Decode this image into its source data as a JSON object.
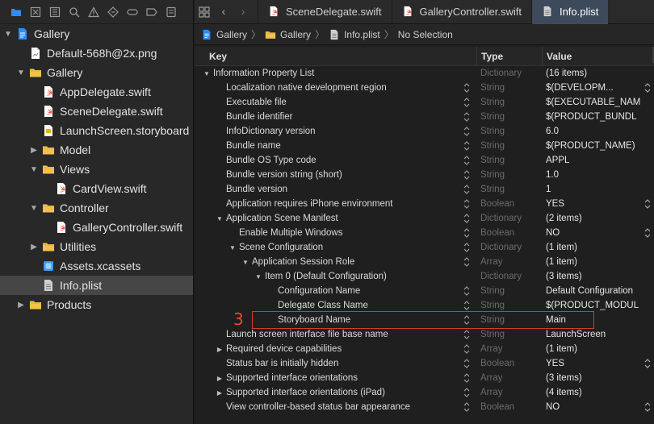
{
  "navigator": {
    "toolbar_icons": [
      "folder-icon",
      "x-square-icon",
      "hierarchy-icon",
      "search-icon",
      "warning-icon",
      "test-icon",
      "debug-icon",
      "breakpoint-icon",
      "report-icon"
    ],
    "tree": [
      {
        "label": "Gallery",
        "level": 0,
        "expanded": true,
        "kind": "project"
      },
      {
        "label": "Default-568h@2x.png",
        "level": 1,
        "kind": "file"
      },
      {
        "label": "Gallery",
        "level": 1,
        "expanded": true,
        "kind": "folder"
      },
      {
        "label": "AppDelegate.swift",
        "level": 2,
        "kind": "swift"
      },
      {
        "label": "SceneDelegate.swift",
        "level": 2,
        "kind": "swift"
      },
      {
        "label": "LaunchScreen.storyboard",
        "level": 2,
        "kind": "storyboard"
      },
      {
        "label": "Model",
        "level": 2,
        "expanded": false,
        "kind": "folder"
      },
      {
        "label": "Views",
        "level": 2,
        "expanded": true,
        "kind": "folder"
      },
      {
        "label": "CardView.swift",
        "level": 3,
        "kind": "swift"
      },
      {
        "label": "Controller",
        "level": 2,
        "expanded": true,
        "kind": "folder"
      },
      {
        "label": "GalleryController.swift",
        "level": 3,
        "kind": "swift"
      },
      {
        "label": "Utilities",
        "level": 2,
        "expanded": false,
        "kind": "folder"
      },
      {
        "label": "Assets.xcassets",
        "level": 2,
        "kind": "assets"
      },
      {
        "label": "Info.plist",
        "level": 2,
        "kind": "plist",
        "selected": true
      },
      {
        "label": "Products",
        "level": 1,
        "expanded": false,
        "kind": "folder"
      }
    ]
  },
  "tabs": [
    {
      "label": "SceneDelegate.swift",
      "active": false,
      "kind": "swift"
    },
    {
      "label": "GalleryController.swift",
      "active": false,
      "kind": "swift"
    },
    {
      "label": "Info.plist",
      "active": true,
      "kind": "plist"
    }
  ],
  "jumpbar": {
    "items": [
      {
        "label": "Gallery",
        "kind": "project"
      },
      {
        "label": "Gallery",
        "kind": "folder"
      },
      {
        "label": "Info.plist",
        "kind": "plist"
      },
      {
        "label": "No Selection",
        "kind": "none"
      }
    ]
  },
  "plist": {
    "headers": {
      "key": "Key",
      "type": "Type",
      "value": "Value"
    },
    "rows": [
      {
        "key": "Information Property List",
        "type": "Dictionary",
        "value": "(16 items)",
        "indent": 0,
        "disclosure": "open",
        "stepper": false,
        "popup": false
      },
      {
        "key": "Localization native development region",
        "type": "String",
        "value": "$(DEVELOPM...",
        "indent": 1,
        "disclosure": "none",
        "stepper": true,
        "popup": true
      },
      {
        "key": "Executable file",
        "type": "String",
        "value": "$(EXECUTABLE_NAM",
        "indent": 1,
        "disclosure": "none",
        "stepper": true,
        "popup": false
      },
      {
        "key": "Bundle identifier",
        "type": "String",
        "value": "$(PRODUCT_BUNDL",
        "indent": 1,
        "disclosure": "none",
        "stepper": true,
        "popup": false
      },
      {
        "key": "InfoDictionary version",
        "type": "String",
        "value": "6.0",
        "indent": 1,
        "disclosure": "none",
        "stepper": true,
        "popup": false
      },
      {
        "key": "Bundle name",
        "type": "String",
        "value": "$(PRODUCT_NAME)",
        "indent": 1,
        "disclosure": "none",
        "stepper": true,
        "popup": false
      },
      {
        "key": "Bundle OS Type code",
        "type": "String",
        "value": "APPL",
        "indent": 1,
        "disclosure": "none",
        "stepper": true,
        "popup": false
      },
      {
        "key": "Bundle version string (short)",
        "type": "String",
        "value": "1.0",
        "indent": 1,
        "disclosure": "none",
        "stepper": true,
        "popup": false
      },
      {
        "key": "Bundle version",
        "type": "String",
        "value": "1",
        "indent": 1,
        "disclosure": "none",
        "stepper": true,
        "popup": false
      },
      {
        "key": "Application requires iPhone environment",
        "type": "Boolean",
        "value": "YES",
        "indent": 1,
        "disclosure": "none",
        "stepper": true,
        "popup": true
      },
      {
        "key": "Application Scene Manifest",
        "type": "Dictionary",
        "value": "(2 items)",
        "indent": 1,
        "disclosure": "open",
        "stepper": true,
        "popup": false
      },
      {
        "key": "Enable Multiple Windows",
        "type": "Boolean",
        "value": "NO",
        "indent": 2,
        "disclosure": "none",
        "stepper": true,
        "popup": true
      },
      {
        "key": "Scene Configuration",
        "type": "Dictionary",
        "value": "(1 item)",
        "indent": 2,
        "disclosure": "open",
        "stepper": true,
        "popup": false
      },
      {
        "key": "Application Session Role",
        "type": "Array",
        "value": "(1 item)",
        "indent": 3,
        "disclosure": "open",
        "stepper": true,
        "popup": false
      },
      {
        "key": "Item 0 (Default Configuration)",
        "type": "Dictionary",
        "value": "(3 items)",
        "indent": 4,
        "disclosure": "open",
        "stepper": false,
        "popup": false
      },
      {
        "key": "Configuration Name",
        "type": "String",
        "value": "Default Configuration",
        "indent": 5,
        "disclosure": "none",
        "stepper": true,
        "popup": false
      },
      {
        "key": "Delegate Class Name",
        "type": "String",
        "value": "$(PRODUCT_MODUL",
        "indent": 5,
        "disclosure": "none",
        "stepper": true,
        "popup": false
      },
      {
        "key": "Storyboard Name",
        "type": "String",
        "value": "Main",
        "indent": 5,
        "disclosure": "none",
        "stepper": true,
        "popup": false
      },
      {
        "key": "Launch screen interface file base name",
        "type": "String",
        "value": "LaunchScreen",
        "indent": 1,
        "disclosure": "none",
        "stepper": true,
        "popup": false
      },
      {
        "key": "Required device capabilities",
        "type": "Array",
        "value": "(1 item)",
        "indent": 1,
        "disclosure": "closed",
        "stepper": true,
        "popup": false
      },
      {
        "key": "Status bar is initially hidden",
        "type": "Boolean",
        "value": "YES",
        "indent": 1,
        "disclosure": "none",
        "stepper": true,
        "popup": true
      },
      {
        "key": "Supported interface orientations",
        "type": "Array",
        "value": "(3 items)",
        "indent": 1,
        "disclosure": "closed",
        "stepper": true,
        "popup": false
      },
      {
        "key": "Supported interface orientations (iPad)",
        "type": "Array",
        "value": "(4 items)",
        "indent": 1,
        "disclosure": "closed",
        "stepper": true,
        "popup": false
      },
      {
        "key": "View controller-based status bar appearance",
        "type": "Boolean",
        "value": "NO",
        "indent": 1,
        "disclosure": "none",
        "stepper": true,
        "popup": true
      }
    ]
  },
  "annotation": {
    "number": "3",
    "color": "#d23b2c"
  },
  "colors": {
    "accent": "#2f8df5",
    "folder": "#f0c24b",
    "swift": "#f05138",
    "selection": "#464646",
    "active_tab": "#3d4a5c"
  }
}
